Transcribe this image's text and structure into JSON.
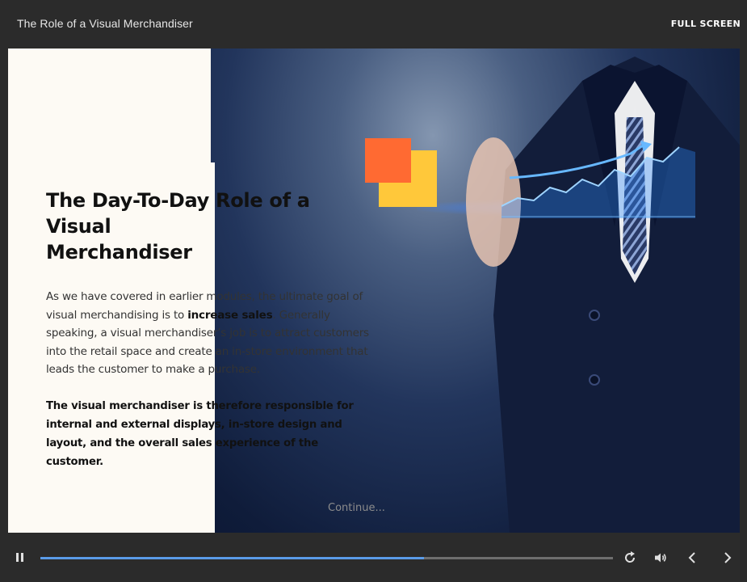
{
  "header": {
    "course_title": "The Role of a Visual Merchandiser",
    "fullscreen_label": "FULL SCREEN"
  },
  "slide": {
    "heading_line1": "The Day-To-Day Role of a Visual",
    "heading_line2": "Merchandiser",
    "para1_prefix": "As we have covered in earlier modules, the ultimate goal of visual merchandising is to ",
    "para1_bold": "increase sales",
    "para1_suffix": ". Generally speaking, a visual merchandiser’s job is to attract customers into the retail space and create an in-store environment that leads the customer to make a purchase.",
    "para2": "The visual merchandiser is therefore responsible for internal and external displays, in-store design and layout, and the overall sales experience of the customer.",
    "continue_label": "Continue...",
    "accent_colors": {
      "orange": "#ff6a32",
      "yellow": "#ffc83a"
    }
  },
  "player": {
    "progress_percent": 67,
    "progress_color": "#5a9be8",
    "icons": [
      "pause-icon",
      "replay-icon",
      "volume-icon",
      "chevron-left-icon",
      "chevron-right-icon"
    ]
  }
}
